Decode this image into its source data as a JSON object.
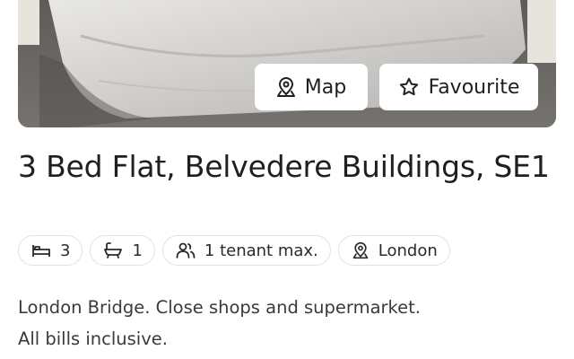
{
  "photo": {
    "map_button_label": "Map",
    "favourite_button_label": "Favourite"
  },
  "listing": {
    "title": "3 Bed Flat, Belvedere Buildings, SE1",
    "features": {
      "bedrooms": "3",
      "bathrooms": "1",
      "tenants": "1 tenant max.",
      "location": "London"
    },
    "description": [
      "London Bridge. Close shops and supermarket.",
      "All bills inclusive."
    ]
  },
  "icons": {
    "map": "map-pin-icon",
    "favourite": "star-icon",
    "bed": "bed-icon",
    "bath": "bath-icon",
    "tenants": "people-icon",
    "location": "location-pin-icon"
  }
}
